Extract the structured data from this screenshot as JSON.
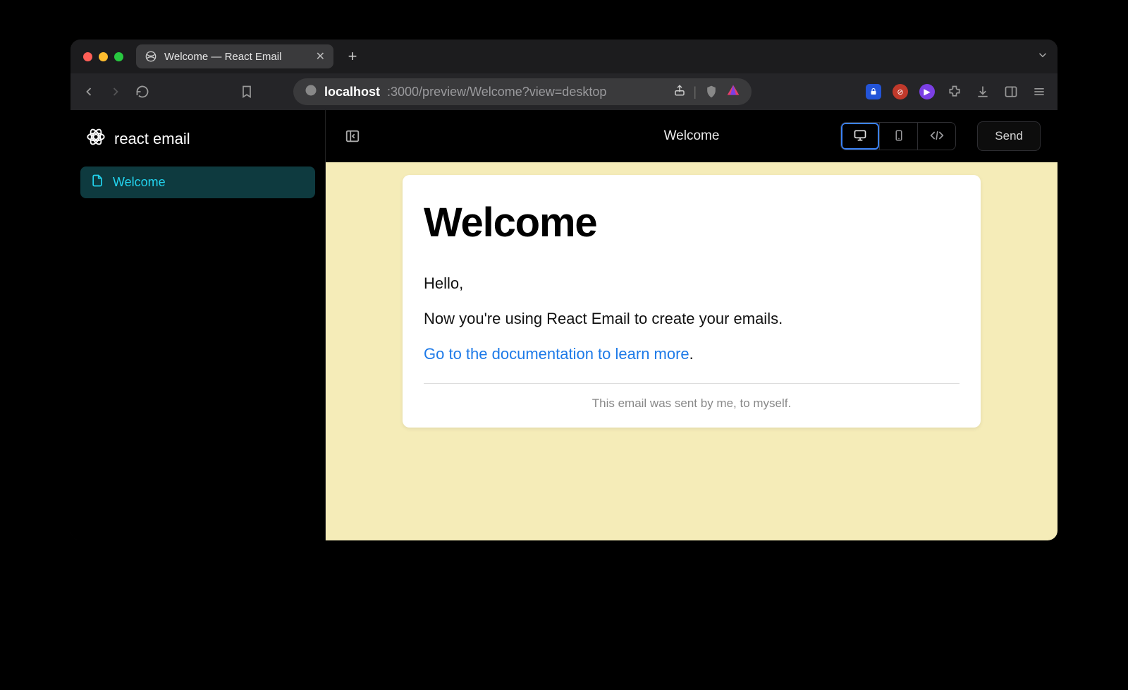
{
  "browser": {
    "tab_title": "Welcome — React Email",
    "url_host": "localhost",
    "url_path": ":3000/preview/Welcome?view=desktop"
  },
  "sidebar": {
    "brand": "react email",
    "item_label": "Welcome"
  },
  "header": {
    "title": "Welcome",
    "send_label": "Send"
  },
  "email": {
    "heading": "Welcome",
    "greeting": "Hello,",
    "body": "Now you're using React Email to create your emails.",
    "link_text": "Go to the documentation to learn more",
    "link_suffix": ".",
    "footer": "This email was sent by me, to myself."
  }
}
